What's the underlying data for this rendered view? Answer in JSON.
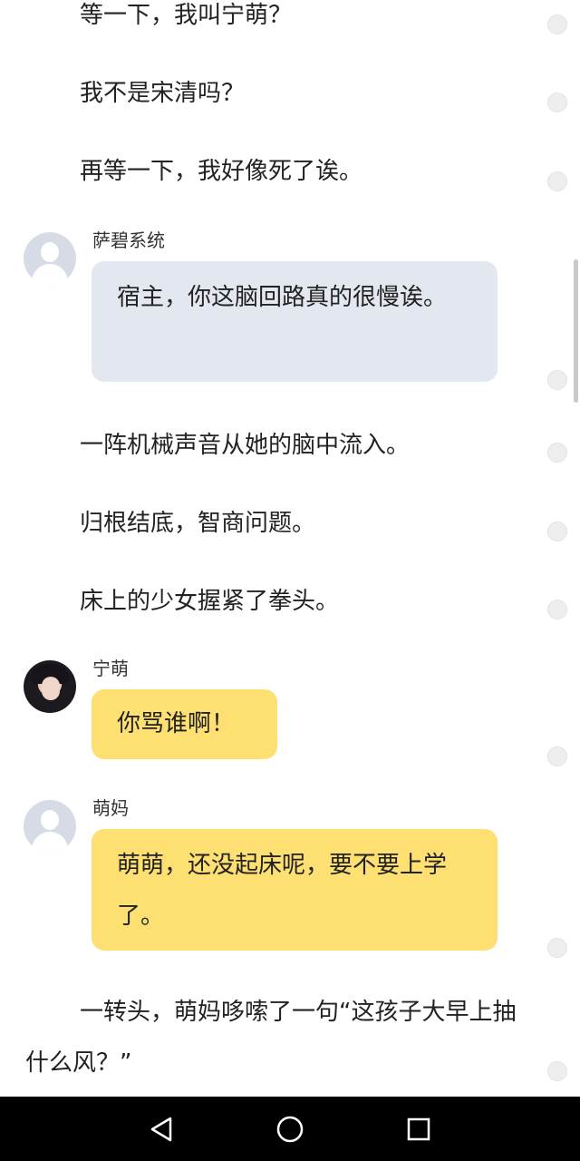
{
  "narration_top": [
    "等一下，我叫宁萌？",
    "我不是宋清吗？",
    "再等一下，我好像死了诶。"
  ],
  "chat1": {
    "speaker": "萨碧系统",
    "message": "宿主，你这脑回路真的很慢诶。"
  },
  "narration_mid": [
    "一阵机械声音从她的脑中流入。",
    "归根结底，智商问题。",
    "床上的少女握紧了拳头。"
  ],
  "chat2": {
    "speaker": "宁萌",
    "message": "你骂谁啊！"
  },
  "chat3": {
    "speaker": "萌妈",
    "message": "萌萌，还没起床呢，要不要上学了。"
  },
  "narration_bottom": "一转头，萌妈哆嗦了一句“这孩子大早上抽什么风？”",
  "icons": {
    "comment": "comment-dot-icon",
    "back": "back-triangle-icon",
    "home": "home-circle-icon",
    "recents": "recents-square-icon"
  },
  "colors": {
    "system_bubble": "#e3e7ef",
    "user_bubble": "#fde071",
    "navbar": "#000000"
  }
}
